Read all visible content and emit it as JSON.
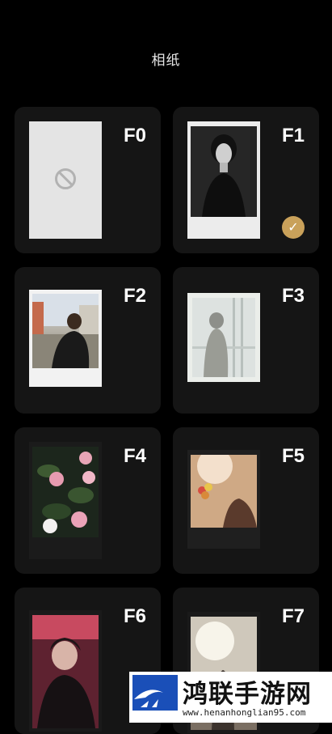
{
  "header": {
    "title": "相纸"
  },
  "papers": [
    {
      "code": "F0",
      "disabled": true
    },
    {
      "code": "F1",
      "selected": true,
      "check_icon": "checkmark-icon"
    },
    {
      "code": "F2"
    },
    {
      "code": "F3"
    },
    {
      "code": "F4"
    },
    {
      "code": "F5"
    },
    {
      "code": "F6"
    },
    {
      "code": "F7"
    }
  ],
  "watermark": {
    "name": "鸿联手游网",
    "url": "www.henanhonglian95.com"
  },
  "colors": {
    "background": "#000000",
    "card": "#151515",
    "accent": "#c9a15a"
  }
}
